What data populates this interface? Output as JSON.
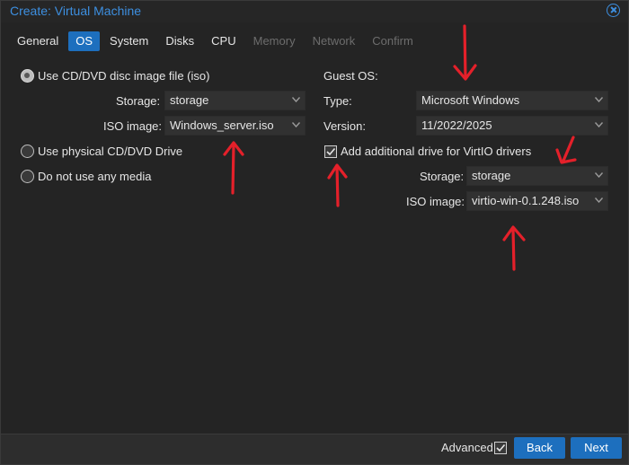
{
  "window": {
    "title": "Create: Virtual Machine",
    "accent": "#1d6fbe",
    "annotation_color": "#e4202a"
  },
  "tabs": [
    {
      "label": "General",
      "state": "normal"
    },
    {
      "label": "OS",
      "state": "active"
    },
    {
      "label": "System",
      "state": "normal"
    },
    {
      "label": "Disks",
      "state": "normal"
    },
    {
      "label": "CPU",
      "state": "normal"
    },
    {
      "label": "Memory",
      "state": "disabled"
    },
    {
      "label": "Network",
      "state": "disabled"
    },
    {
      "label": "Confirm",
      "state": "disabled"
    }
  ],
  "media": {
    "iso_option": "Use CD/DVD disc image file (iso)",
    "storage_label": "Storage:",
    "storage_value": "storage",
    "iso_label": "ISO image:",
    "iso_value": "Windows_server.iso",
    "physical_option": "Use physical CD/DVD Drive",
    "none_option": "Do not use any media",
    "selected": "iso"
  },
  "guest_os": {
    "heading": "Guest OS:",
    "type_label": "Type:",
    "type_value": "Microsoft Windows",
    "version_label": "Version:",
    "version_value": "11/2022/2025",
    "virtio_label": "Add additional drive for VirtIO drivers",
    "virtio_checked": true,
    "virtio_storage_label": "Storage:",
    "virtio_storage_value": "storage",
    "virtio_iso_label": "ISO image:",
    "virtio_iso_value": "virtio-win-0.1.248.iso"
  },
  "footer": {
    "advanced_label": "Advanced",
    "advanced_checked": true,
    "back_label": "Back",
    "next_label": "Next"
  }
}
